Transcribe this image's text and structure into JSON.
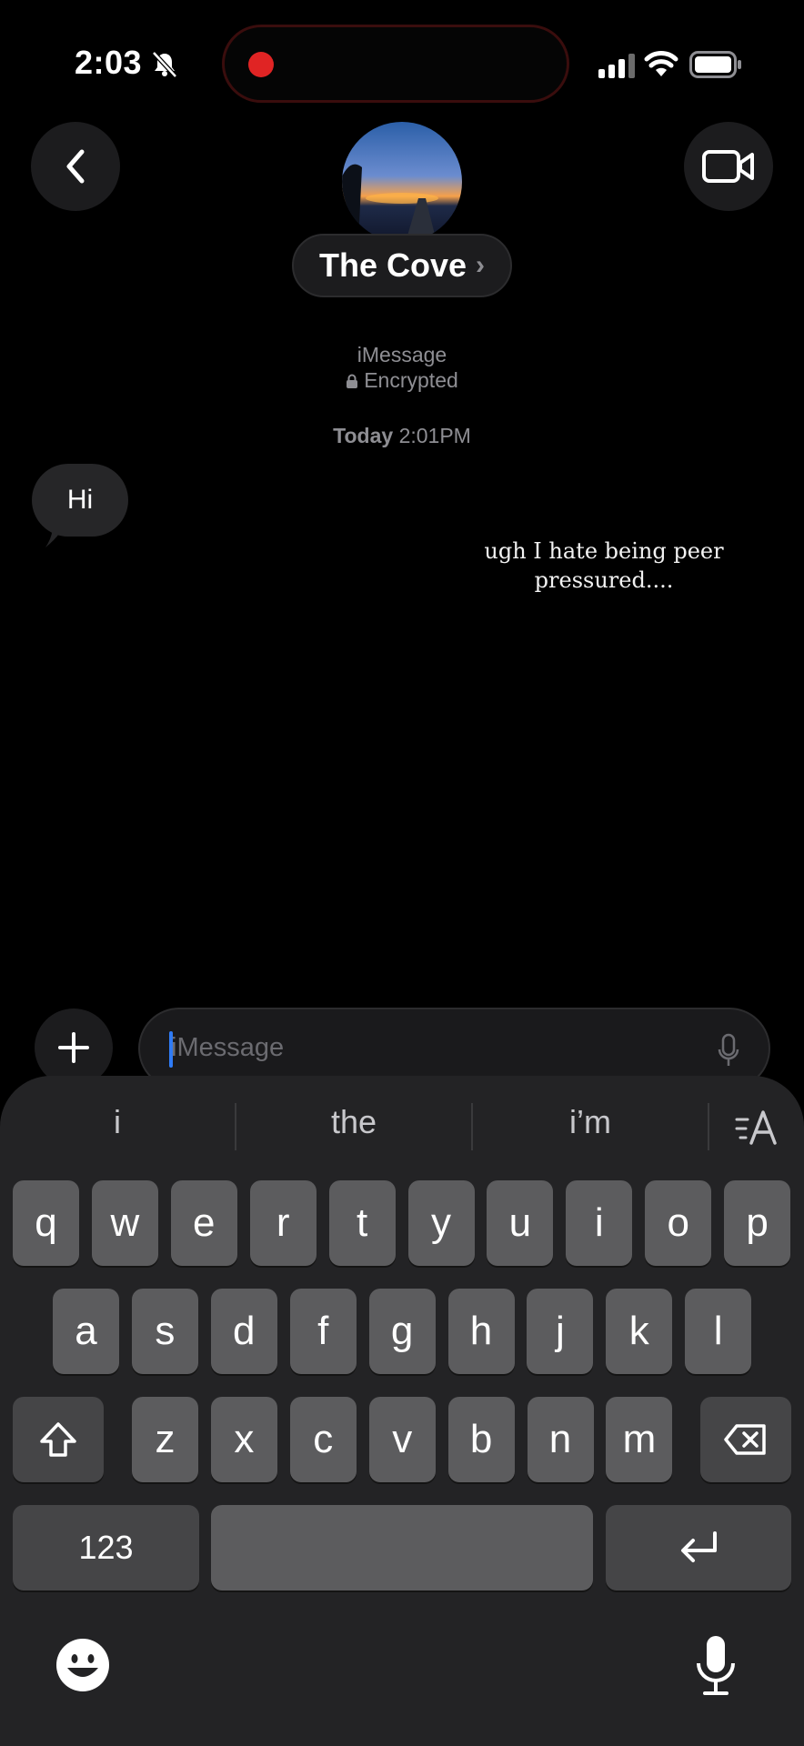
{
  "status_bar": {
    "time": "2:03"
  },
  "header": {
    "contact_name": "The Cove",
    "chevron": "›"
  },
  "service": {
    "line1": "iMessage",
    "line2": "Encrypted"
  },
  "timestamp": {
    "day": "Today",
    "time": "2:01PM"
  },
  "messages": [
    {
      "text": "Hi",
      "direction": "incoming"
    }
  ],
  "overlay_caption": "ugh I hate being peer pressured....",
  "input": {
    "placeholder": "iMessage"
  },
  "suggestions": [
    "i",
    "the",
    "i’m"
  ],
  "keyboard": {
    "row1": [
      "q",
      "w",
      "e",
      "r",
      "t",
      "y",
      "u",
      "i",
      "o",
      "p"
    ],
    "row2": [
      "a",
      "s",
      "d",
      "f",
      "g",
      "h",
      "j",
      "k",
      "l"
    ],
    "row3": [
      "z",
      "x",
      "c",
      "v",
      "b",
      "n",
      "m"
    ],
    "numbers_label": "123"
  },
  "colors": {
    "background": "#000000",
    "bubble": "#262628",
    "caret": "#2f7bf6",
    "record": "#e02424",
    "keyboard": "#232325",
    "key": "#5c5c5e"
  }
}
